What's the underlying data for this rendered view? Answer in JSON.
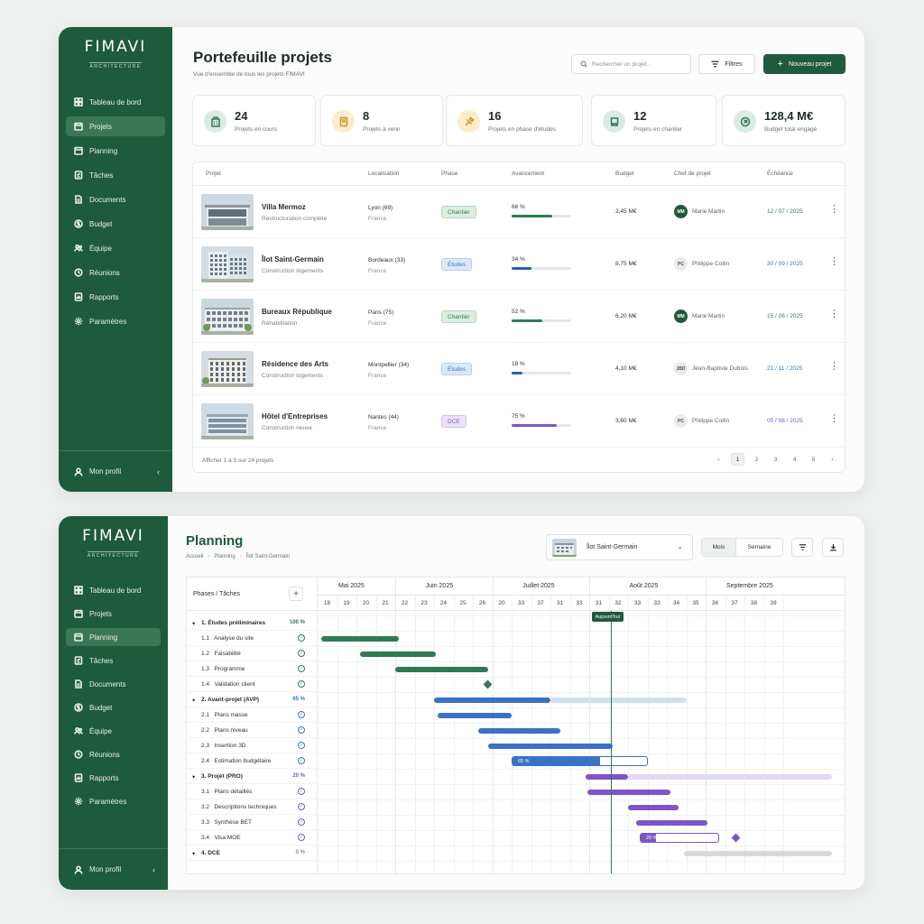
{
  "brand": {
    "name": "FIMAVI",
    "sub": "ARCHITECTURE"
  },
  "nav1": [
    {
      "label": "Tableau de bord",
      "icon": "dashboard-icon"
    },
    {
      "label": "Projets",
      "icon": "folder-icon",
      "active": true
    },
    {
      "label": "Planning",
      "icon": "calendar-icon"
    },
    {
      "label": "Tâches",
      "icon": "tasks-icon"
    },
    {
      "label": "Documents",
      "icon": "document-icon"
    },
    {
      "label": "Budget",
      "icon": "budget-icon"
    },
    {
      "label": "Équipe",
      "icon": "team-icon"
    },
    {
      "label": "Réunions",
      "icon": "meeting-icon"
    },
    {
      "label": "Rapports",
      "icon": "report-icon"
    },
    {
      "label": "Paramètres",
      "icon": "gear-icon"
    }
  ],
  "nav2": [
    {
      "label": "Tableau de bord",
      "icon": "dashboard-icon"
    },
    {
      "label": "Projets",
      "icon": "folder-icon"
    },
    {
      "label": "Planning",
      "icon": "calendar-icon",
      "active": true
    },
    {
      "label": "Tâches",
      "icon": "tasks-icon"
    },
    {
      "label": "Documents",
      "icon": "document-icon"
    },
    {
      "label": "Budget",
      "icon": "budget-icon"
    },
    {
      "label": "Équipe",
      "icon": "team-icon"
    },
    {
      "label": "Réunions",
      "icon": "meeting-icon"
    },
    {
      "label": "Rapports",
      "icon": "report-icon"
    },
    {
      "label": "Paramètres",
      "icon": "gear-icon"
    }
  ],
  "profile": {
    "label": "Mon profil"
  },
  "portfolio": {
    "title": "Portefeuille projets",
    "subtitle": "Vue d'ensemble de tous les projets FIMAVI",
    "search_placeholder": "Rechercher un projet...",
    "filter_label": "Filtres",
    "new_label": "Nouveau projet",
    "stats": [
      {
        "value": "24",
        "label": "Projets en cours",
        "color": "#dcebe1",
        "stroke": "#2f7a55"
      },
      {
        "value": "8",
        "label": "Projets à venir",
        "color": "#fbeccb",
        "stroke": "#c9922a"
      },
      {
        "value": "16",
        "label": "Projets en phase d'études",
        "color": "#fbeccb",
        "stroke": "#c9922a"
      },
      {
        "value": "12",
        "label": "Projets en chantier",
        "color": "#dcebe1",
        "stroke": "#2f7a55"
      },
      {
        "value": "128,4 M€",
        "label": "Budget total engagé",
        "color": "#dcebe1",
        "stroke": "#2f7a55"
      }
    ],
    "columns": [
      "Projet",
      "Localisation",
      "Phase",
      "Avancement",
      "Budget",
      "Chef de projet",
      "Échéance"
    ],
    "rows": [
      {
        "name": "Villa Mermoz",
        "type": "Restructuration complète",
        "loc": "Lyon (69)",
        "country": "France",
        "phase": "Chantier",
        "pct": "68 %",
        "progress": 0.68,
        "budget": "2,45 M€",
        "initials": "MM",
        "chef": "Marie Martin",
        "date": "12 / 07 / 2025"
      },
      {
        "name": "Îlot Saint-Germain",
        "type": "Construction logements",
        "loc": "Bordeaux (33)",
        "country": "France",
        "phase": "Études",
        "pct": "34 %",
        "progress": 0.34,
        "budget": "8,75 M€",
        "initials": "PC",
        "chef": "Philippe Collin",
        "date": "30 / 09 / 2025"
      },
      {
        "name": "Bureaux République",
        "type": "Réhabilitation",
        "loc": "Paris (75)",
        "country": "France",
        "phase": "Chantier",
        "pct": "52 %",
        "progress": 0.52,
        "budget": "6,20 M€",
        "initials": "MM",
        "chef": "Marie Martin",
        "date": "15 / 06 / 2025"
      },
      {
        "name": "Résidence des Arts",
        "type": "Construction logements",
        "loc": "Montpellier (34)",
        "country": "France",
        "phase": "Études",
        "pct": "18 %",
        "progress": 0.18,
        "budget": "4,10 M€",
        "initials": "JBD",
        "chef": "Jean-Baptiste Dubois",
        "date": "21 / 11 / 2025"
      },
      {
        "name": "Hôtel d'Entreprises",
        "type": "Construction neuve",
        "loc": "Nantes (44)",
        "country": "France",
        "phase": "DCE",
        "pct": "75 %",
        "progress": 0.75,
        "budget": "3,60 M€",
        "initials": "PC",
        "chef": "Philippe Collin",
        "date": "05 / 08 / 2025"
      }
    ],
    "footer": "Afficher 1 à 5 sur 24 projets",
    "pages": [
      "1",
      "2",
      "3",
      "4",
      "5"
    ]
  },
  "planning": {
    "title": "Planning",
    "crumbs": [
      "Accueil",
      "Planning",
      "Îlot Saint-Germain"
    ],
    "project": "Îlot Saint-Germain",
    "view_month": "Mois",
    "view_week": "Semaine",
    "col_header": "Phases / Tâches",
    "months": [
      "Mai 2025",
      "Juin 2025",
      "Juillet 2025",
      "Août 2025",
      "Septembre 2025"
    ],
    "weeks": [
      "18",
      "19",
      "20",
      "21",
      "22",
      "23",
      "24",
      "25",
      "26",
      "20",
      "33",
      "37",
      "31",
      "33",
      "31",
      "32",
      "33",
      "33",
      "34",
      "35",
      "36",
      "37",
      "38",
      "39"
    ],
    "today_label": "Aujourd'hui",
    "tasks": [
      {
        "label": "1. Études préliminaires",
        "kind": "phase",
        "pct": "100 %",
        "color": "#2f7a55"
      },
      {
        "label": "1.1   Analyse du site",
        "kind": "task",
        "color": "#2f7a55"
      },
      {
        "label": "1.2   Faisabilité",
        "kind": "task",
        "color": "#2f7a55"
      },
      {
        "label": "1.3   Programme",
        "kind": "task",
        "color": "#2f7a55"
      },
      {
        "label": "1.4   Validation client",
        "kind": "task",
        "color": "#2f7a55"
      },
      {
        "label": "2. Avant-projet (AVP)",
        "kind": "phase",
        "pct": "65 %",
        "color": "#3a72c4"
      },
      {
        "label": "2.1   Plans masse",
        "kind": "task",
        "color": "#3a72c4"
      },
      {
        "label": "2.2   Plans niveau",
        "kind": "task",
        "color": "#3a72c4"
      },
      {
        "label": "2.3   Insertion 3D",
        "kind": "task",
        "color": "#3a72c4"
      },
      {
        "label": "2.4   Estimation budgétaire",
        "kind": "task",
        "color": "#3a72c4"
      },
      {
        "label": "3. Projet (PRO)",
        "kind": "phase",
        "pct": "20 %",
        "color": "#7d55c7"
      },
      {
        "label": "3.1   Plans détaillés",
        "kind": "task",
        "color": "#7d55c7"
      },
      {
        "label": "3.2   Descriptions techniques",
        "kind": "task",
        "color": "#7d55c7"
      },
      {
        "label": "3.3   Synthèse BET",
        "kind": "task",
        "color": "#7d55c7"
      },
      {
        "label": "3.4   Visa MOE",
        "kind": "task",
        "color": "#7d55c7"
      },
      {
        "label": "4. DCE",
        "kind": "phase",
        "pct": "0 %",
        "color": "#8a938d"
      }
    ],
    "progress_labels": {
      "estimation": "65 %",
      "visa": "20 %"
    }
  },
  "colors": {
    "brand": "#1e5a3e",
    "green": "#2f7a55",
    "blue": "#3a72c4",
    "purple": "#7d55c7"
  }
}
